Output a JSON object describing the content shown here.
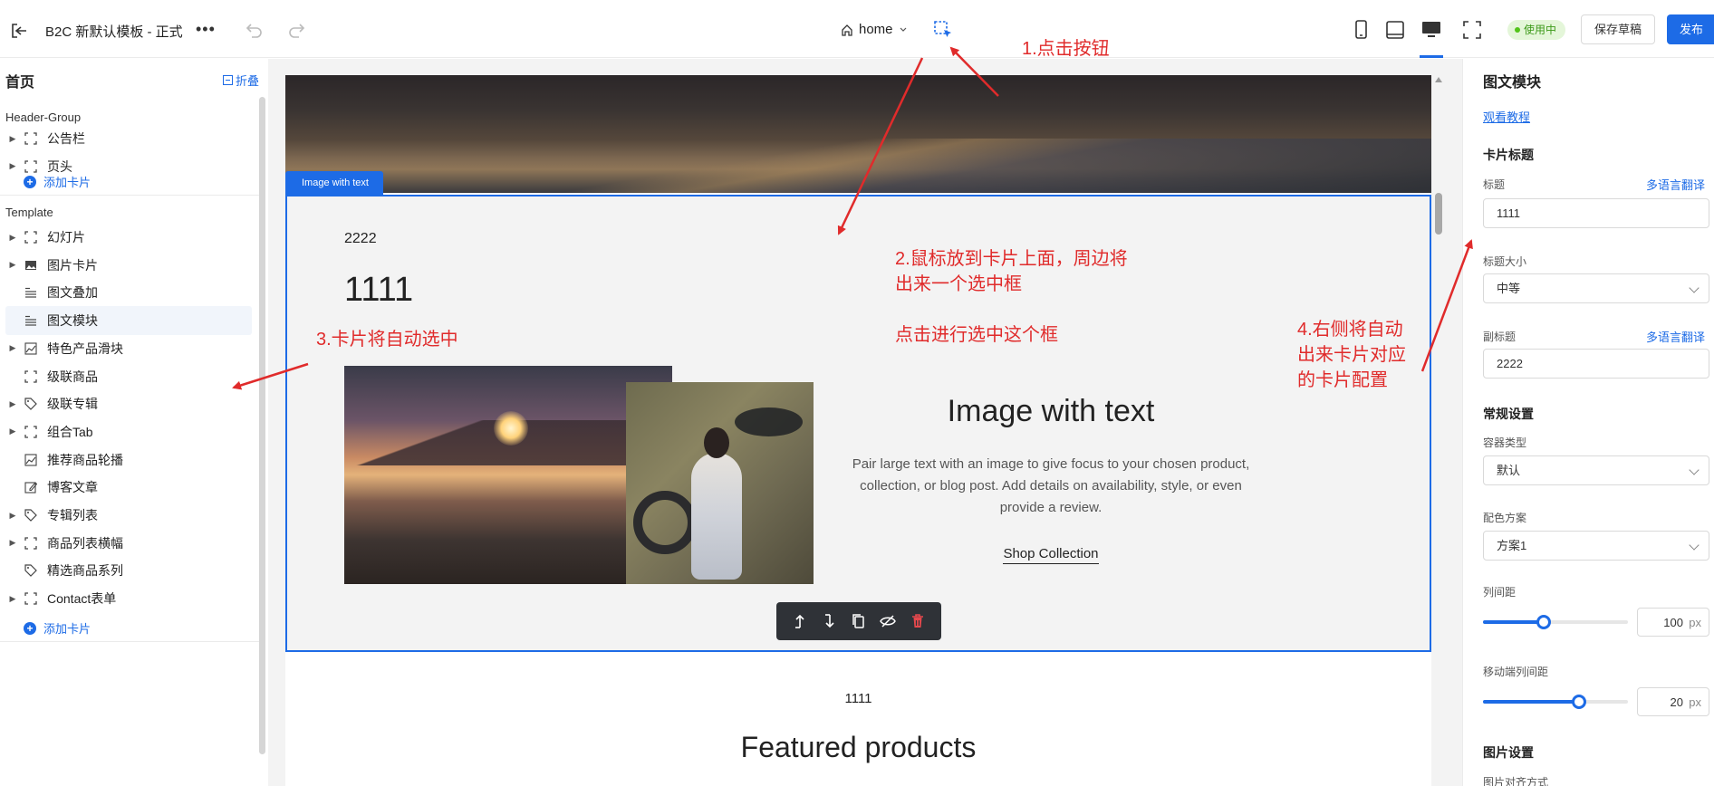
{
  "topbar": {
    "title": "B2C 新默认模板 - 正式",
    "more": "•••",
    "page": "home",
    "status": "使用中",
    "save_draft": "保存草稿",
    "publish": "发布"
  },
  "sidebar": {
    "title": "首页",
    "fold": "折叠",
    "group_header": "Header-Group",
    "header_items": [
      {
        "label": "公告栏",
        "icon": "frame-icon",
        "has_caret": true
      },
      {
        "label": "页头",
        "icon": "frame-icon",
        "has_caret": true
      }
    ],
    "add_card": "添加卡片",
    "group_template": "Template",
    "template_items": [
      {
        "label": "幻灯片",
        "icon": "frame-icon",
        "has_caret": true
      },
      {
        "label": "图片卡片",
        "icon": "image-icon",
        "has_caret": true
      },
      {
        "label": "图文叠加",
        "icon": "text-image-icon",
        "has_caret": false
      },
      {
        "label": "图文模块",
        "icon": "text-image-icon",
        "has_caret": false,
        "active": true
      },
      {
        "label": "特色产品滑块",
        "icon": "chart-icon",
        "has_caret": true
      },
      {
        "label": "级联商品",
        "icon": "frame-icon",
        "has_caret": false
      },
      {
        "label": "级联专辑",
        "icon": "tag-icon",
        "has_caret": true
      },
      {
        "label": "组合Tab",
        "icon": "frame-icon",
        "has_caret": true
      },
      {
        "label": "推荐商品轮播",
        "icon": "chart-icon",
        "has_caret": false
      },
      {
        "label": "博客文章",
        "icon": "edit-icon",
        "has_caret": false
      },
      {
        "label": "专辑列表",
        "icon": "tag-icon",
        "has_caret": true
      },
      {
        "label": "商品列表横幅",
        "icon": "frame-icon",
        "has_caret": true
      },
      {
        "label": "精选商品系列",
        "icon": "tag-icon",
        "has_caret": false
      },
      {
        "label": "Contact表单",
        "icon": "frame-icon",
        "has_caret": true
      }
    ],
    "add_card_2": "添加卡片"
  },
  "canvas": {
    "selected_tag": "Image with text",
    "subtitle": "2222",
    "title": "1111",
    "it_title": "Image with text",
    "it_desc": "Pair large text with an image to give focus to your chosen product, collection, or blog post. Add details on availability, style, or even provide a review.",
    "it_link": "Shop Collection",
    "next_sub": "1111",
    "next_title": "Featured products"
  },
  "panel": {
    "title": "图文模块",
    "tutorial": "观看教程",
    "card_title_section": "卡片标题",
    "title_label": "标题",
    "translate": "多语言翻译",
    "title_value": "1111",
    "title_size_label": "标题大小",
    "title_size_value": "中等",
    "subtitle_label": "副标题",
    "subtitle_value": "2222",
    "general_section": "常规设置",
    "container_label": "容器类型",
    "container_value": "默认",
    "color_label": "配色方案",
    "color_value": "方案1",
    "col_gap_label": "列间距",
    "col_gap_value": "100",
    "col_gap_unit": "px",
    "col_gap_fraction": 0.42,
    "mobile_gap_label": "移动端列间距",
    "mobile_gap_value": "20",
    "mobile_gap_unit": "px",
    "mobile_gap_fraction": 0.66,
    "image_section": "图片设置",
    "image_align_label": "图片对齐方式"
  },
  "annotations": {
    "a1": "1.点击按钮",
    "a2_line1": "2.鼠标放到卡片上面，周边将",
    "a2_line2": "出来一个选中框",
    "a2_line3": "点击进行选中这个框",
    "a3": "3.卡片将自动选中",
    "a4_line1": "4.右侧将自动",
    "a4_line2": "出来卡片对应",
    "a4_line3": "的卡片配置"
  },
  "colors": {
    "accent": "#1d6be6",
    "annotation": "#e02b2b",
    "status_bg": "#e4f6d9",
    "status_text": "#3d9a1a",
    "delete": "#e5484d"
  }
}
